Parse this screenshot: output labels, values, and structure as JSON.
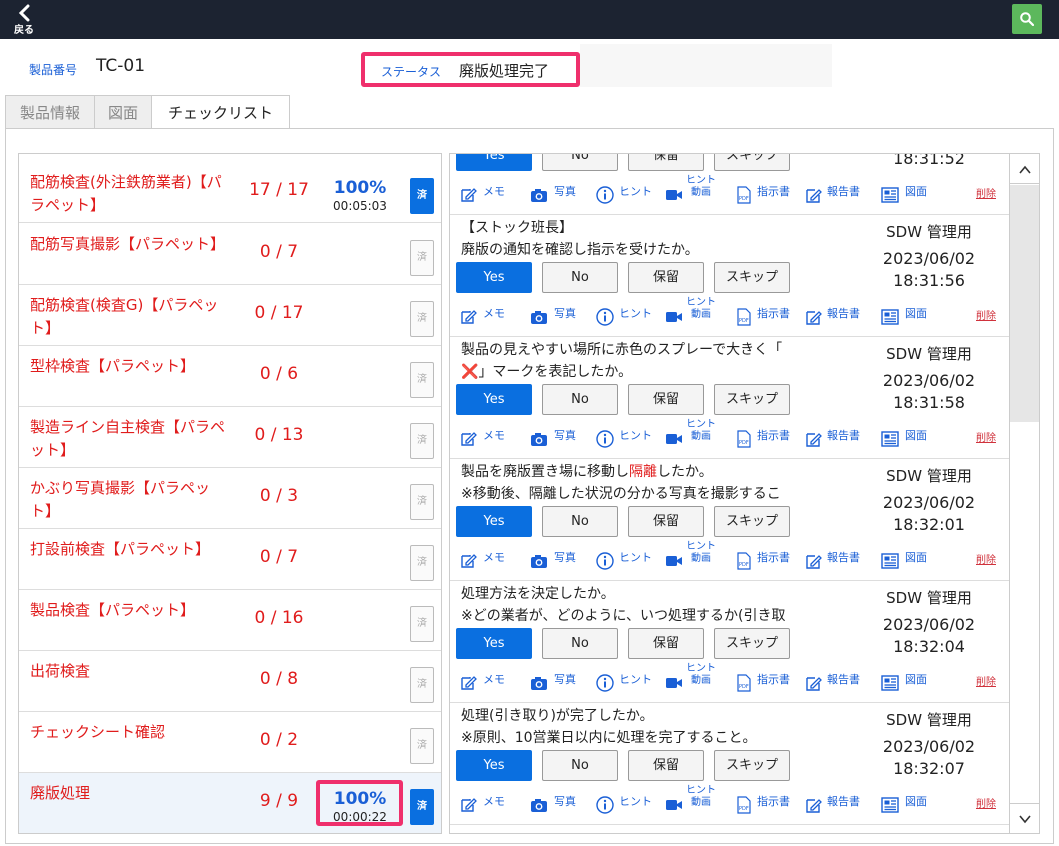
{
  "topbar": {
    "back_label": "戻る",
    "back_icon": "chevron-left-icon",
    "search_icon": "search-icon",
    "search_color": "#5cb85c"
  },
  "info": {
    "product_number_label": "製品番号",
    "product_number": "TC-01",
    "status_label": "ステータス",
    "status_value": "廃版処理完了"
  },
  "tabs": [
    {
      "label": "製品情報",
      "active": false
    },
    {
      "label": "図面",
      "active": false
    },
    {
      "label": "チェックリスト",
      "active": true
    }
  ],
  "done_label": "済",
  "checklists": [
    {
      "name": "配筋検査(外注鉄筋業者)【パラペット】",
      "count": "17 / 17",
      "percent": "100%",
      "time": "00:05:03",
      "done": true
    },
    {
      "name": "配筋写真撮影【パラペット】",
      "count": "0 / 7",
      "percent": "",
      "time": "",
      "done": false
    },
    {
      "name": "配筋検査(検査G)【パラペット】",
      "count": "0 / 17",
      "percent": "",
      "time": "",
      "done": false
    },
    {
      "name": "型枠検査【パラペット】",
      "count": "0 / 6",
      "percent": "",
      "time": "",
      "done": false
    },
    {
      "name": "製造ライン自主検査【パラペット】",
      "count": "0 / 13",
      "percent": "",
      "time": "",
      "done": false
    },
    {
      "name": "かぶり写真撮影【パラペット】",
      "count": "0 / 3",
      "percent": "",
      "time": "",
      "done": false
    },
    {
      "name": "打設前検査【パラペット】",
      "count": "0 / 7",
      "percent": "",
      "time": "",
      "done": false
    },
    {
      "name": "製品検査【パラペット】",
      "count": "0 / 16",
      "percent": "",
      "time": "",
      "done": false
    },
    {
      "name": "出荷検査",
      "count": "0 / 8",
      "percent": "",
      "time": "",
      "done": false
    },
    {
      "name": "チェックシート確認",
      "count": "0 / 2",
      "percent": "",
      "time": "",
      "done": false
    },
    {
      "name": "廃版処理",
      "count": "9 / 9",
      "percent": "100%",
      "time": "00:00:22",
      "done": true,
      "active": true
    }
  ],
  "answer_buttons": [
    "Yes",
    "No",
    "保留",
    "スキップ"
  ],
  "tools": {
    "memo": "メモ",
    "photo": "写真",
    "hint": "ヒント",
    "hint_video_1": "ヒント",
    "hint_video_2": "動画",
    "instruction": "指示書",
    "report": "報告書",
    "drawing": "図面",
    "delete": "削除"
  },
  "questions": [
    {
      "line1": "",
      "line2": "",
      "who": "",
      "date": "",
      "time": "18:31:52",
      "answer": "Yes"
    },
    {
      "line1": "【ストック班長】",
      "line2": "廃版の通知を確認し指示を受けたか。",
      "who": "SDW 管理用",
      "date": "2023/06/02",
      "time": "18:31:56",
      "answer": "Yes"
    },
    {
      "line1": "製品の見えやすい場所に赤色のスプレーで大きく「",
      "line2_mark": "❌",
      "line2": "」マークを表記したか。",
      "who": "SDW 管理用",
      "date": "2023/06/02",
      "time": "18:31:58",
      "answer": "Yes"
    },
    {
      "line1_a": "製品を廃版置き場に移動し",
      "line1_red": "隔離",
      "line1_b": "したか。",
      "line2": "※移動後、隔離した状況の分かる写真を撮影するこ",
      "who": "SDW 管理用",
      "date": "2023/06/02",
      "time": "18:32:01",
      "answer": "Yes"
    },
    {
      "line1": "処理方法を決定したか。",
      "line2": "※どの業者が、どのように、いつ処理するか(引き取",
      "who": "SDW 管理用",
      "date": "2023/06/02",
      "time": "18:32:04",
      "answer": "Yes"
    },
    {
      "line1": "処理(引き取り)が完了したか。",
      "line2": "※原則、10営業日以内に処理を完了すること。",
      "who": "SDW 管理用",
      "date": "2023/06/02",
      "time": "18:32:07",
      "answer": "Yes"
    }
  ],
  "colors": {
    "accent": "#0a6fe0",
    "highlight": "#ef2f6c",
    "error_text": "#e01c1c",
    "topbar": "#1c2331"
  }
}
